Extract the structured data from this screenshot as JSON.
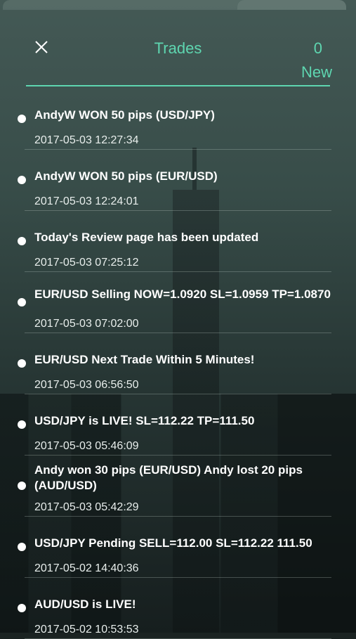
{
  "header": {
    "title": "Trades",
    "count": "0",
    "new_label": "New",
    "close_icon": "close-icon"
  },
  "colors": {
    "accent": "#5ed6b0",
    "text": "#ffffff"
  },
  "items": [
    {
      "text": "AndyW WON 50 pips (USD/JPY)",
      "time": "2017-05-03 12:27:34"
    },
    {
      "text": "AndyW WON 50 pips (EUR/USD)",
      "time": "2017-05-03 12:24:01"
    },
    {
      "text": "Today's Review page has been updated",
      "time": "2017-05-03 07:25:12"
    },
    {
      "text": "EUR/USD Selling NOW=1.0920 SL=1.0959 TP=1.0870",
      "time": "2017-05-03 07:02:00"
    },
    {
      "text": "EUR/USD Next Trade Within 5 Minutes!",
      "time": "2017-05-03 06:56:50"
    },
    {
      "text": "USD/JPY is LIVE! SL=112.22 TP=111.50",
      "time": "2017-05-03 05:46:09"
    },
    {
      "text": "Andy won 30 pips (EUR/USD) Andy lost 20 pips (AUD/USD)",
      "time": "2017-05-03 05:42:29"
    },
    {
      "text": "USD/JPY Pending SELL=112.00 SL=112.22 111.50",
      "time": "2017-05-02 14:40:36"
    },
    {
      "text": "AUD/USD is LIVE!",
      "time": "2017-05-02 10:53:53"
    }
  ]
}
